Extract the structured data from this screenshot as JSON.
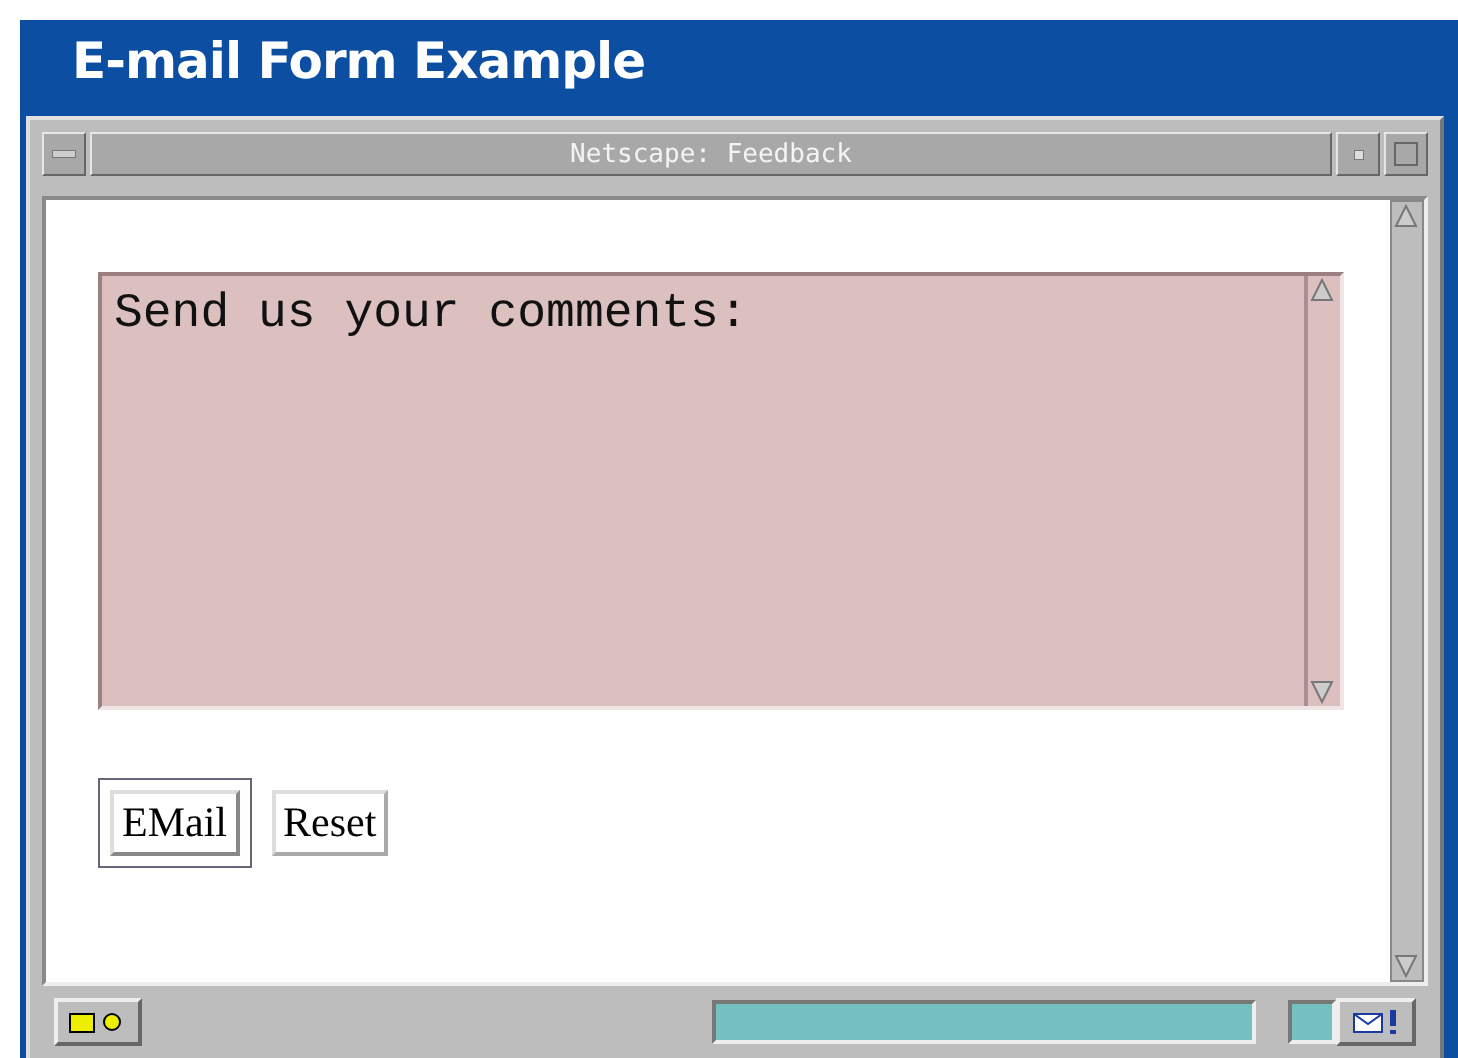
{
  "slide": {
    "title": "E-mail Form Example"
  },
  "window": {
    "title": "Netscape: Feedback"
  },
  "form": {
    "comments": "Send us your comments:",
    "buttons": [
      {
        "label": "EMail",
        "focused": true
      },
      {
        "label": "Reset",
        "focused": false
      }
    ]
  },
  "status_bar": {
    "progress": {
      "level": 1
    }
  }
}
